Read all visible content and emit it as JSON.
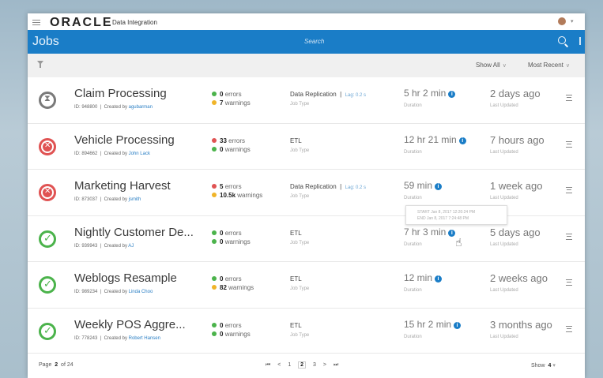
{
  "brand": {
    "logo": "ORACLE",
    "product": "Data Integration"
  },
  "header": {
    "title": "Jobs",
    "search_placeholder": "Search"
  },
  "filters": {
    "show": "Show All",
    "sort": "Most Recent"
  },
  "jobs": [
    {
      "name": "Claim Processing",
      "id": "ID: 948800",
      "created_prefix": "Created by",
      "creator": "agubarman",
      "status": "running",
      "errors": "0",
      "errors_label": "errors",
      "warnings": "7",
      "warnings_label": "warnings",
      "type": "Data Replication",
      "lag": "Lag: 0.2 s",
      "type_label": "Job Type",
      "duration": "5 hr 2 min",
      "duration_label": "Duration",
      "updated": "2 days ago",
      "updated_label": "Last Updated"
    },
    {
      "name": "Vehicle Processing",
      "id": "ID: 894662",
      "created_prefix": "Created by",
      "creator": "John Lack",
      "status": "failed",
      "errors": "33",
      "errors_label": "errors",
      "warnings": "0",
      "warnings_label": "warnings",
      "type": "ETL",
      "lag": "",
      "type_label": "Job Type",
      "duration": "12 hr 21 min",
      "duration_label": "Duration",
      "updated": "7 hours ago",
      "updated_label": "Last Updated"
    },
    {
      "name": "Marketing Harvest",
      "id": "ID: 873037",
      "created_prefix": "Created by",
      "creator": "jsmith",
      "status": "failed",
      "errors": "5",
      "errors_label": "errors",
      "warnings": "10.5k",
      "warnings_label": "warnings",
      "type": "Data Replication",
      "lag": "Lag: 0.2 s",
      "type_label": "Job Type",
      "duration": "59 min",
      "duration_label": "Duration",
      "updated": "1 week ago",
      "updated_label": "Last Updated"
    },
    {
      "name": "Nightly Customer De...",
      "id": "ID: 939943",
      "created_prefix": "Created by",
      "creator": "AJ",
      "status": "success",
      "errors": "0",
      "errors_label": "errors",
      "warnings": "0",
      "warnings_label": "warnings",
      "type": "ETL",
      "lag": "",
      "type_label": "Job Type",
      "duration": "7 hr 3 min",
      "duration_label": "Duration",
      "updated": "5 days ago",
      "updated_label": "Last Updated"
    },
    {
      "name": "Weblogs Resample",
      "id": "ID: 989234",
      "created_prefix": "Created by",
      "creator": "Linda Choo",
      "status": "success",
      "errors": "0",
      "errors_label": "errors",
      "warnings": "82",
      "warnings_label": "warnings",
      "type": "ETL",
      "lag": "",
      "type_label": "Job Type",
      "duration": "12 min",
      "duration_label": "Duration",
      "updated": "2 weeks ago",
      "updated_label": "Last Updated"
    },
    {
      "name": "Weekly POS Aggre...",
      "id": "ID: 778243",
      "created_prefix": "Created by",
      "creator": "Robert Hansen",
      "status": "success",
      "errors": "0",
      "errors_label": "errors",
      "warnings": "0",
      "warnings_label": "warnings",
      "type": "ETL",
      "lag": "",
      "type_label": "Job Type",
      "duration": "15 hr 2 min",
      "duration_label": "Duration",
      "updated": "3 months ago",
      "updated_label": "Last Updated"
    }
  ],
  "tooltip": {
    "start": "START  Jan 8, 2017 12:20:24 PM",
    "end": "END   Jan 8, 2017  7:24:48 PM"
  },
  "footer": {
    "page_label": "Page",
    "page": "2",
    "of": "of 24",
    "pager": {
      "first": "⏮",
      "prev": "<",
      "p1": "1",
      "p2": "2",
      "p3": "3",
      "next": ">",
      "last": "⏭"
    },
    "show_label": "Show",
    "show_value": "4"
  }
}
